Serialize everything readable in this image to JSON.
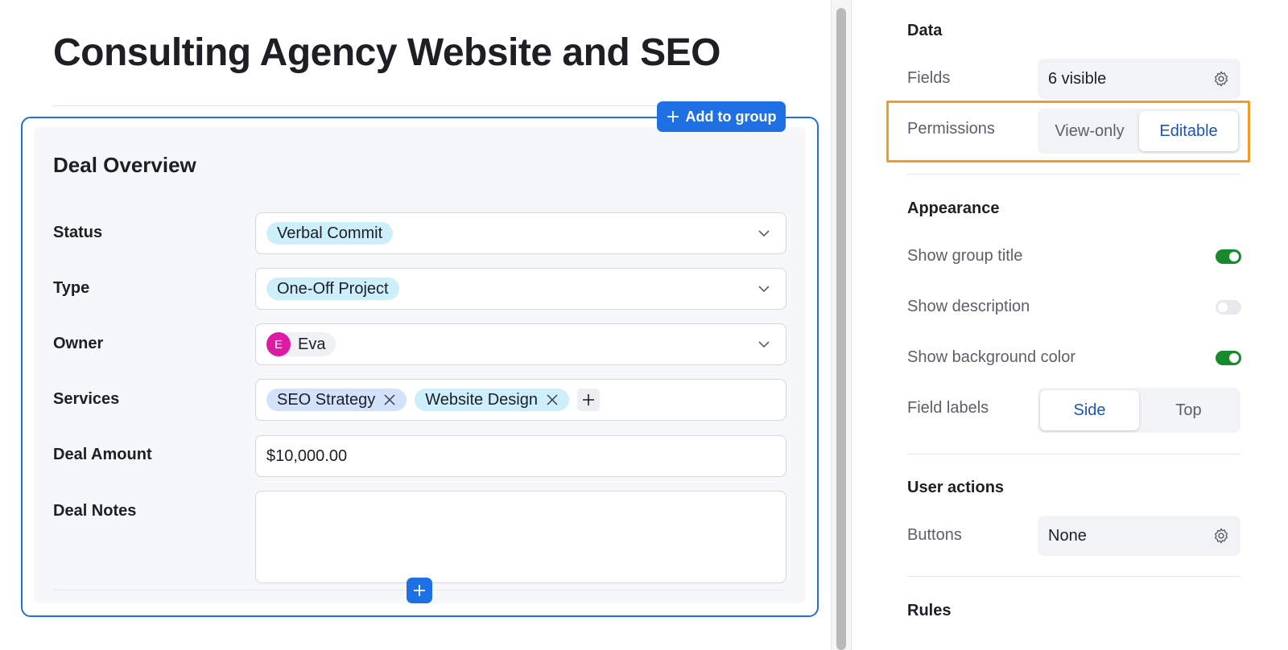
{
  "page": {
    "title": "Consulting Agency Website and SEO"
  },
  "group": {
    "title": "Deal Overview",
    "add_to_group_label": "Add to group",
    "fields": {
      "status": {
        "label": "Status",
        "value": "Verbal Commit"
      },
      "type": {
        "label": "Type",
        "value": "One-Off Project"
      },
      "owner": {
        "label": "Owner",
        "value": "Eva",
        "initial": "E"
      },
      "services": {
        "label": "Services",
        "values": [
          "SEO Strategy",
          "Website Design"
        ]
      },
      "deal_amount": {
        "label": "Deal Amount",
        "value": "$10,000.00"
      },
      "deal_notes": {
        "label": "Deal Notes",
        "value": ""
      }
    }
  },
  "panel": {
    "data": {
      "title": "Data",
      "fields_label": "Fields",
      "fields_value": "6 visible",
      "permissions_label": "Permissions",
      "permissions_options": [
        "View-only",
        "Editable"
      ],
      "permissions_selected": "Editable"
    },
    "appearance": {
      "title": "Appearance",
      "show_group_title_label": "Show group title",
      "show_group_title": true,
      "show_description_label": "Show description",
      "show_description": false,
      "show_background_color_label": "Show background color",
      "show_background_color": true,
      "field_labels_label": "Field labels",
      "field_labels_options": [
        "Side",
        "Top"
      ],
      "field_labels_selected": "Side"
    },
    "user_actions": {
      "title": "User actions",
      "buttons_label": "Buttons",
      "buttons_value": "None"
    },
    "rules": {
      "title": "Rules"
    }
  },
  "colors": {
    "accent": "#1f6fe5",
    "highlight": "#f59a23",
    "toggle_on": "#178a2e",
    "pill_cyan": "#cdeefb",
    "pill_blue": "#d3e1fb",
    "avatar": "#de1aa4"
  },
  "icons": [
    "plus-icon",
    "chevron-down-icon",
    "close-icon",
    "gear-icon"
  ]
}
